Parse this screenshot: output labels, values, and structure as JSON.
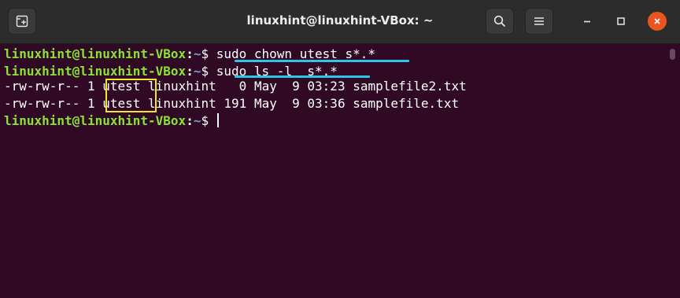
{
  "window": {
    "title": "linuxhint@linuxhint-VBox: ~"
  },
  "titlebar": {
    "icons": {
      "new_tab": "new-tab-icon",
      "search": "search-icon",
      "menu": "hamburger-menu-icon",
      "minimize": "minimize-icon",
      "maximize": "maximize-icon",
      "close": "close-icon"
    }
  },
  "terminal": {
    "prompt": {
      "user_host": "linuxhint@linuxhint-VBox",
      "colon": ":",
      "path": "~",
      "dollar": "$ "
    },
    "commands": [
      "sudo chown utest s*.*",
      "sudo ls -l  s*.*"
    ],
    "output": [
      {
        "perms": "-rw-rw-r--",
        "links": "1",
        "owner": "utest",
        "group": "linuxhint",
        "size": "  0",
        "month": "May",
        "day": " 9",
        "time": "03:23",
        "name": "samplefile2.txt"
      },
      {
        "perms": "-rw-rw-r--",
        "links": "1",
        "owner": "utest",
        "group": "linuxhint",
        "size": "191",
        "month": "May",
        "day": " 9",
        "time": "03:36",
        "name": "samplefile.txt"
      }
    ]
  },
  "colors": {
    "terminal_bg": "#300a24",
    "titlebar_bg": "#2c2c2c",
    "prompt_user": "#8ae234",
    "prompt_path": "#729fcf",
    "underline": "#2ec5e8",
    "highlight_box": "#f2e52b",
    "close_button": "#e95420"
  }
}
